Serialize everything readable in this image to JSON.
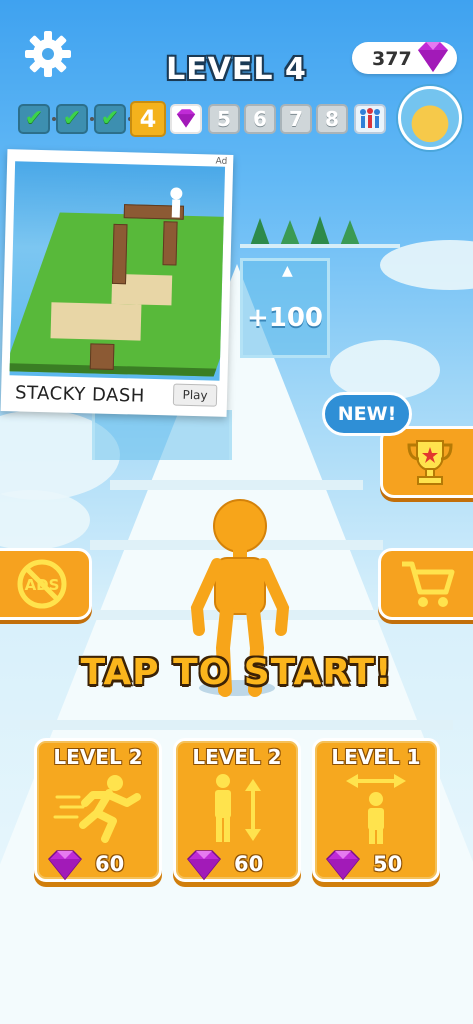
{
  "hud": {
    "level_title": "LEVEL 4",
    "gem_count": "377",
    "settings_icon": "gear-icon"
  },
  "progress": {
    "stages": [
      {
        "type": "done",
        "label": ""
      },
      {
        "type": "done",
        "label": ""
      },
      {
        "type": "done",
        "label": ""
      },
      {
        "type": "current",
        "label": "4"
      },
      {
        "type": "gem",
        "label": ""
      },
      {
        "type": "future",
        "label": "5"
      },
      {
        "type": "future",
        "label": "6"
      },
      {
        "type": "future",
        "label": "7"
      },
      {
        "type": "future",
        "label": "8"
      },
      {
        "type": "boss",
        "label": ""
      }
    ]
  },
  "gate": {
    "value": "+100"
  },
  "ad": {
    "tag": "Ad",
    "title": "STACKY DASH",
    "play_label": "Play"
  },
  "badges": {
    "new_label": "NEW!"
  },
  "main": {
    "tap_to_start": "TAP TO START!"
  },
  "upgrades": [
    {
      "level": "LEVEL 2",
      "cost": "60",
      "icon": "running-man-icon"
    },
    {
      "level": "LEVEL 2",
      "cost": "60",
      "icon": "height-icon"
    },
    {
      "level": "LEVEL 1",
      "cost": "50",
      "icon": "width-icon"
    }
  ],
  "colors": {
    "accent_orange": "#f6a21f",
    "text_yellow": "#fbb51c",
    "gem_purple": "#c02bd6",
    "player_orange": "#f7a51a"
  }
}
